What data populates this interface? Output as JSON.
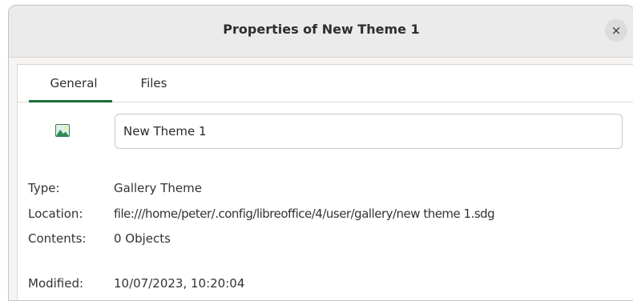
{
  "dialog": {
    "title": "Properties of New Theme 1",
    "close_symbol": "×"
  },
  "tabs": [
    {
      "label": "General",
      "active": true
    },
    {
      "label": "Files",
      "active": false
    }
  ],
  "general": {
    "icon": "gallery-image-icon",
    "name_value": "New Theme 1",
    "type_label": "Type:",
    "type_value": "Gallery Theme",
    "location_label": "Location:",
    "location_value": "file:///home/peter/.config/libreoffice/4/user/gallery/new theme 1.sdg",
    "contents_label": "Contents:",
    "contents_value": "0 Objects",
    "modified_label": "Modified:",
    "modified_value": "10/07/2023, 10:20:04"
  },
  "colors": {
    "accent": "#1b6c3c",
    "titlebar": "#ebebeb"
  }
}
